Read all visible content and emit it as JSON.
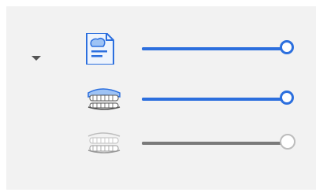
{
  "panel": {
    "colors": {
      "background": "#f2f2f2",
      "accent": "#2c6fde",
      "muted": "#7a7a7a",
      "thumb_disabled": "#bdbdbd"
    },
    "collapse_icon": "chevron-down-icon",
    "rows": [
      {
        "icon": "scan-document-icon",
        "slider_value": 1.0,
        "enabled": true
      },
      {
        "icon": "upper-jaw-teeth-icon",
        "slider_value": 1.0,
        "enabled": true
      },
      {
        "icon": "lower-jaw-teeth-icon",
        "slider_value": 1.0,
        "enabled": false
      }
    ]
  }
}
